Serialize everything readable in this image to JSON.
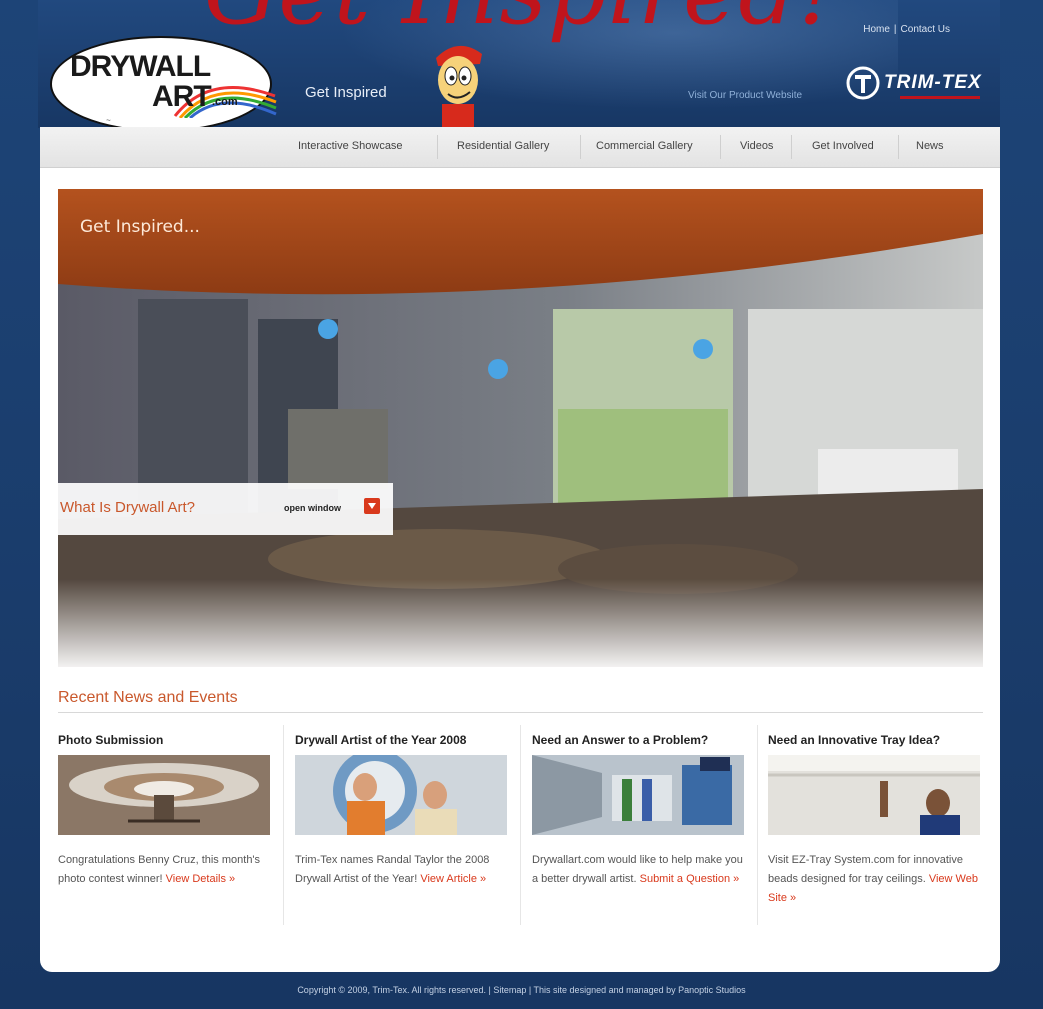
{
  "overlay_title": "Get Inspired!",
  "header": {
    "top_links": [
      "Home",
      "Contact Us"
    ],
    "logo": {
      "line1": "DRYWALL",
      "line2": "ART",
      "com": ".com"
    },
    "tagline": "Get Inspired",
    "product_link": "Visit Our Product Website",
    "partner_logo": "TRIM-TEX"
  },
  "nav": {
    "items": [
      "Interactive Showcase",
      "Residential Gallery",
      "Commercial Gallery",
      "Videos",
      "Get Involved",
      "News"
    ]
  },
  "hero": {
    "banner_text": "Get Inspired...",
    "drywall_title": "What Is Drywall Art?",
    "open_window": "open window"
  },
  "news": {
    "heading": "Recent News and Events",
    "items": [
      {
        "title": "Photo Submission",
        "text": "Congratulations Benny Cruz, this month's photo contest winner!",
        "link": "View Details »"
      },
      {
        "title": "Drywall Artist of the Year 2008",
        "text": "Trim-Tex names Randal Taylor the 2008 Drywall Artist of the Year!",
        "link": "View Article »"
      },
      {
        "title": "Need an Answer to a Problem?",
        "text": "Drywallart.com would like to help make you a better drywall artist.",
        "link": "Submit a Question »"
      },
      {
        "title": "Need an Innovative Tray Idea?",
        "text": "Visit EZ-Tray System.com for innovative beads designed for tray ceilings.",
        "link": "View Web Site »"
      }
    ]
  },
  "footer": {
    "text": "Copyright © 2009, Trim-Tex. All rights reserved. | Sitemap | This site designed and managed by Panoptic Studios"
  },
  "colors": {
    "background": "#1b3d6e",
    "accent": "#c9582c",
    "link": "#d9391c",
    "overlay": "#c0141c"
  }
}
